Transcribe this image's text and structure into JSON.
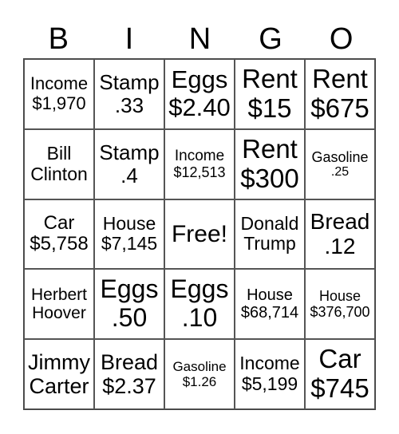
{
  "header": [
    "B",
    "I",
    "N",
    "G",
    "O"
  ],
  "cells": [
    [
      "Income",
      "$1,970"
    ],
    [
      "Stamp",
      ".33"
    ],
    [
      "Eggs",
      "$2.40"
    ],
    [
      "Rent",
      "$15"
    ],
    [
      "Rent",
      "$675"
    ],
    [
      "Bill",
      "Clinton"
    ],
    [
      "Stamp",
      ".4"
    ],
    [
      "Income",
      "$12,513"
    ],
    [
      "Rent",
      "$300"
    ],
    [
      "Gasoline",
      ".25"
    ],
    [
      "Car",
      "$5,758"
    ],
    [
      "House",
      "$7,145"
    ],
    [
      "Free!"
    ],
    [
      "Donald",
      "Trump"
    ],
    [
      "Bread",
      ".12"
    ],
    [
      "Herbert",
      "Hoover"
    ],
    [
      "Eggs",
      ".50"
    ],
    [
      "Eggs",
      ".10"
    ],
    [
      "House",
      "$68,714"
    ],
    [
      "House",
      "$376,700"
    ],
    [
      "Jimmy",
      "Carter"
    ],
    [
      "Bread",
      "$2.37"
    ],
    [
      "Gasoline",
      "$1.26"
    ],
    [
      "Income",
      "$5,199"
    ],
    [
      "Car",
      "$745"
    ]
  ]
}
